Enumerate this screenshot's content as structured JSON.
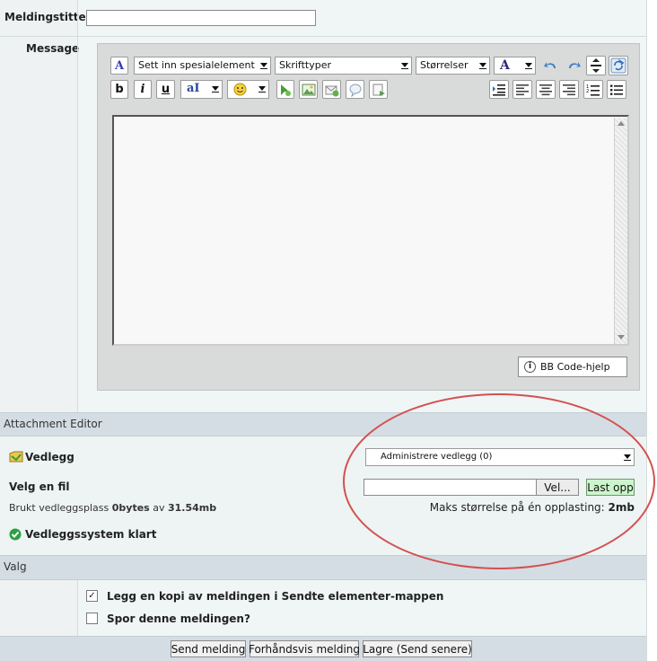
{
  "fields": {
    "title_label": "Meldingstittel",
    "title_value": "",
    "message_label": "Message"
  },
  "toolbar": {
    "special_element": "Sett inn spesialelement",
    "font_types": "Skrifttyper",
    "sizes": "Størrelser",
    "font_color_glyph": "A",
    "bold": "b",
    "italic": "i",
    "underline": "u",
    "text_style_glyph": "aI"
  },
  "editor": {
    "body": "",
    "bbcode_help": "BB Code-hjelp"
  },
  "attachment": {
    "section_title": "Attachment Editor",
    "label": "Vedlegg",
    "manage_select": "Administrere vedlegg (0)",
    "choose_file_label": "Velg en fil",
    "file_path": "",
    "browse_button": "Vel...",
    "upload_button": "Last opp",
    "used_space_prefix": "Brukt vedleggsplass",
    "used_space_value": "0bytes",
    "used_space_of": "av",
    "used_space_total": "31.54mb",
    "max_size_prefix": "Maks størrelse på én opplasting:",
    "max_size_value": "2mb",
    "status": "Vedleggssystem klart"
  },
  "options": {
    "section_title": "Valg",
    "copy_to_sent": {
      "label": "Legg en kopi av meldingen i Sendte elementer-mappen",
      "checked": true,
      "mark": "✓"
    },
    "track_message": {
      "label": "Spor denne meldingen?",
      "checked": false
    }
  },
  "actions": {
    "send": "Send melding",
    "preview": "Forhåndsvis melding",
    "save": "Lagre (Send senere)"
  },
  "colors": {
    "upload_green": "#cdf5cd",
    "annotation_red": "#d35050",
    "status_green": "#2ea043"
  }
}
